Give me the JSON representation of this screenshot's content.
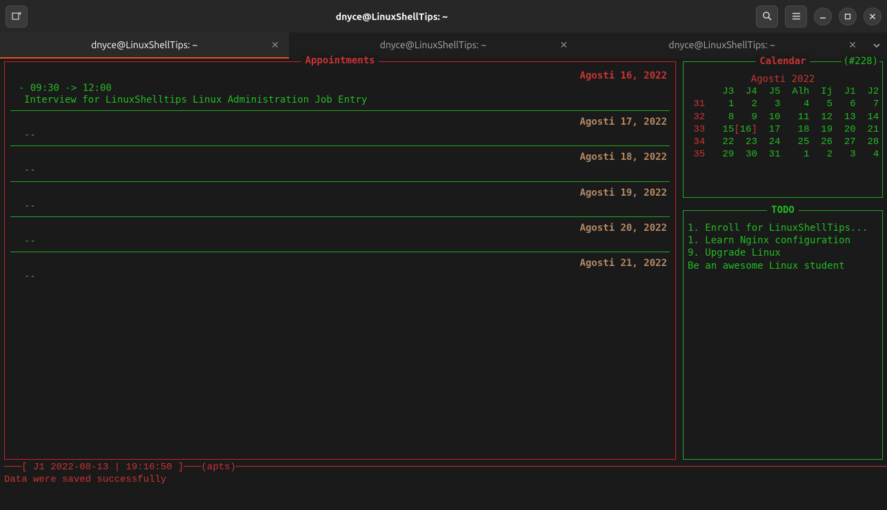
{
  "window": {
    "title": "dnyce@LinuxShellTips: ~"
  },
  "tabs": [
    {
      "label": "dnyce@LinuxShellTips: ~",
      "active": true
    },
    {
      "label": "dnyce@LinuxShellTips: ~",
      "active": false
    },
    {
      "label": "dnyce@LinuxShellTips: ~",
      "active": false
    }
  ],
  "appointments": {
    "title": "Appointments",
    "days": [
      {
        "date": "Agosti 16, 2022",
        "selected": true,
        "items": [
          {
            "time": "- 09:30 -> 12:00",
            "text": "Interview for LinuxShelltips Linux Administration Job Entry"
          }
        ]
      },
      {
        "date": "Agosti 17, 2022",
        "selected": false,
        "items": [
          {
            "time": "",
            "text": "--"
          }
        ]
      },
      {
        "date": "Agosti 18, 2022",
        "selected": false,
        "items": [
          {
            "time": "",
            "text": "--"
          }
        ]
      },
      {
        "date": "Agosti 19, 2022",
        "selected": false,
        "items": [
          {
            "time": "",
            "text": "--"
          }
        ]
      },
      {
        "date": "Agosti 20, 2022",
        "selected": false,
        "items": [
          {
            "time": "",
            "text": "--"
          }
        ]
      },
      {
        "date": "Agosti 21, 2022",
        "selected": false,
        "items": [
          {
            "time": "",
            "text": "--"
          }
        ]
      }
    ]
  },
  "calendar": {
    "title": "Calendar",
    "corner": "(#228)",
    "month": "Agosti 2022",
    "dayhead": [
      "J3",
      "J4",
      "J5",
      "Alh",
      "Ij",
      "J1",
      "J2"
    ],
    "weeks": [
      {
        "wk": "31",
        "days": [
          "1",
          "2",
          "3",
          "4",
          "5",
          "6",
          "7"
        ]
      },
      {
        "wk": "32",
        "days": [
          "8",
          "9",
          "10",
          "11",
          "12",
          "13",
          "14"
        ]
      },
      {
        "wk": "33",
        "days": [
          "15",
          "[16]",
          "17",
          "18",
          "19",
          "20",
          "21"
        ],
        "today_idx": 1
      },
      {
        "wk": "34",
        "days": [
          "22",
          "23",
          "24",
          "25",
          "26",
          "27",
          "28"
        ]
      },
      {
        "wk": "35",
        "days": [
          "29",
          "30",
          "31",
          "1",
          "2",
          "3",
          "4"
        ],
        "out_from": 3
      }
    ]
  },
  "todo": {
    "title": "TODO",
    "items": [
      "1. Enroll for LinuxShellTips...",
      "1. Learn Nginx configuration",
      "9. Upgrade Linux",
      "Be an awesome Linux student"
    ]
  },
  "status": {
    "line1_pre": "───[ ",
    "line1_mid": "J1 2022-08-13 | 19:16:50",
    "line1_post": " ]───(apts)",
    "line2": "Data were saved successfully"
  }
}
